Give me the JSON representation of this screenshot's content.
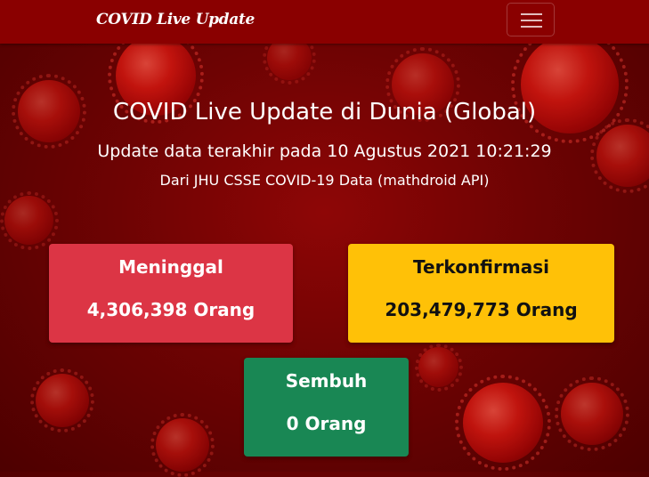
{
  "navbar": {
    "brand": "COVID Live Update",
    "toggler_icon": "hamburger-menu-icon"
  },
  "header": {
    "title": "COVID Live Update di Dunia (Global)",
    "updated": "Update data terakhir pada 10 Agustus 2021 10:21:29",
    "source": "Dari JHU CSSE COVID-19 Data (mathdroid API)"
  },
  "cards": {
    "deaths": {
      "label": "Meninggal",
      "value": "4,306,398 Orang",
      "color": "#dc3545"
    },
    "confirmed": {
      "label": "Terkonfirmasi",
      "value": "203,479,773 Orang",
      "color": "#ffc107"
    },
    "recovered": {
      "label": "Sembuh",
      "value": "0 Orang",
      "color": "#198754"
    }
  },
  "theme": {
    "navbar_bg": "#8a0000",
    "page_bg": "#6e0303"
  }
}
